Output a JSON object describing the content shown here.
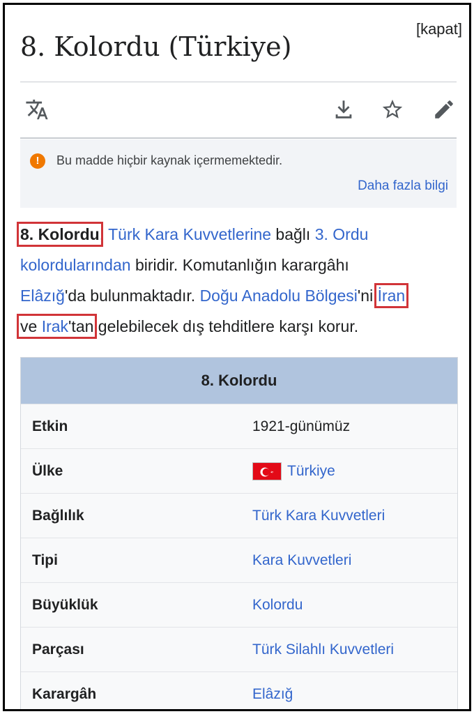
{
  "header": {
    "close_label": "[kapat]",
    "title": "8. Kolordu (Türkiye)"
  },
  "toolbar": {
    "icons": [
      "translate-icon",
      "download-icon",
      "star-icon",
      "edit-icon"
    ]
  },
  "notice": {
    "icon": "!",
    "text": "Bu madde hiçbir kaynak içermemektedir.",
    "more_link": "Daha fazla bilgi"
  },
  "paragraph": {
    "l1_bold": "8. Kolordu",
    "l1_comma": ",",
    "l1_link1": "Türk Kara Kuvvetlerine",
    "l1_text1": " bağlı ",
    "l1_link2": "3. Ordu",
    "l2_link1": "kolordularından",
    "l2_text1": " biridir. Komutanlığın karargâhı",
    "l3_link1": "Elâzığ",
    "l3_text1": "'da bulunmaktadır. ",
    "l3_link2": "Doğu Anadolu Bölgesi",
    "l3_text2": "'ni ",
    "l3_link3": "İran",
    "l4_text1": "ve ",
    "l4_link1": "Irak",
    "l4_text2": "'tan",
    "l4_text3": " gelebilecek dış tehditlere karşı korur."
  },
  "infobox": {
    "title": "8. Kolordu",
    "rows": [
      {
        "label": "Etkin",
        "value": "1921-günümüz"
      },
      {
        "label": "Ülke",
        "value": "Türkiye"
      },
      {
        "label": "Bağlılık",
        "value": "Türk Kara Kuvvetleri"
      },
      {
        "label": "Tipi",
        "value": "Kara Kuvvetleri"
      },
      {
        "label": "Büyüklük",
        "value": "Kolordu"
      },
      {
        "label": "Parçası",
        "value": "Türk Silahlı Kuvvetleri"
      },
      {
        "label": "Karargâh",
        "value": "Elâzığ"
      }
    ]
  },
  "colors": {
    "link": "#3366cc",
    "highlight": "#d13438",
    "infobox_header": "#b0c4de",
    "notice_icon": "#f07800",
    "flag_red": "#e30a17"
  }
}
